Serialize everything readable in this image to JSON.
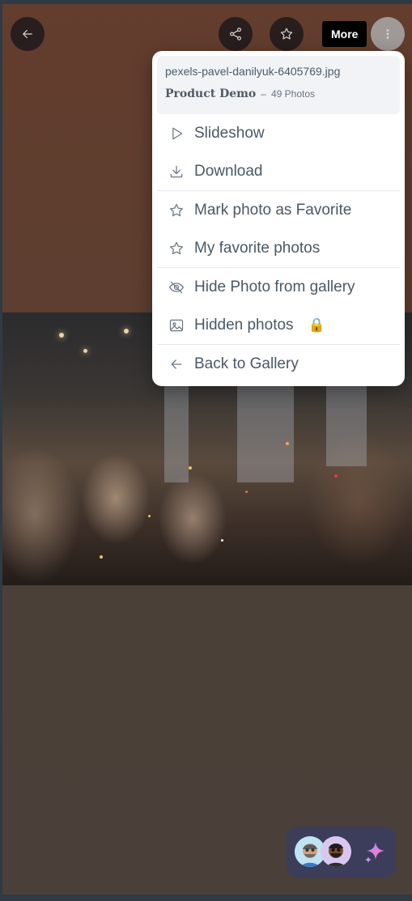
{
  "toolbar": {
    "back_icon": "arrow-left-icon",
    "share_icon": "share-icon",
    "favorite_icon": "star-icon",
    "more_tooltip": "More"
  },
  "menu": {
    "filename": "pexels-pavel-danilyuk-6405769.jpg",
    "album_name": "Product Demo",
    "separator": "–",
    "photo_count": "49 Photos",
    "items": [
      {
        "label": "Slideshow",
        "icon": "play-icon"
      },
      {
        "label": "Download",
        "icon": "download-icon"
      },
      {
        "label": "Mark photo as Favorite",
        "icon": "star-icon"
      },
      {
        "label": "My favorite photos",
        "icon": "star-icon"
      },
      {
        "label": "Hide Photo from gallery",
        "icon": "eye-off-icon"
      },
      {
        "label": "Hidden photos",
        "icon": "image-icon",
        "badge": "🔒"
      },
      {
        "label": "Back to Gallery",
        "icon": "arrow-left-icon"
      }
    ]
  },
  "chat": {
    "avatars": [
      "avatar-1",
      "avatar-2"
    ],
    "icon": "sparkle-icon"
  },
  "colors": {
    "backdrop_top": "#633d2d",
    "backdrop_bottom": "#4a4039",
    "widget": "#3b3d5a",
    "menu_text": "#4a5866"
  }
}
